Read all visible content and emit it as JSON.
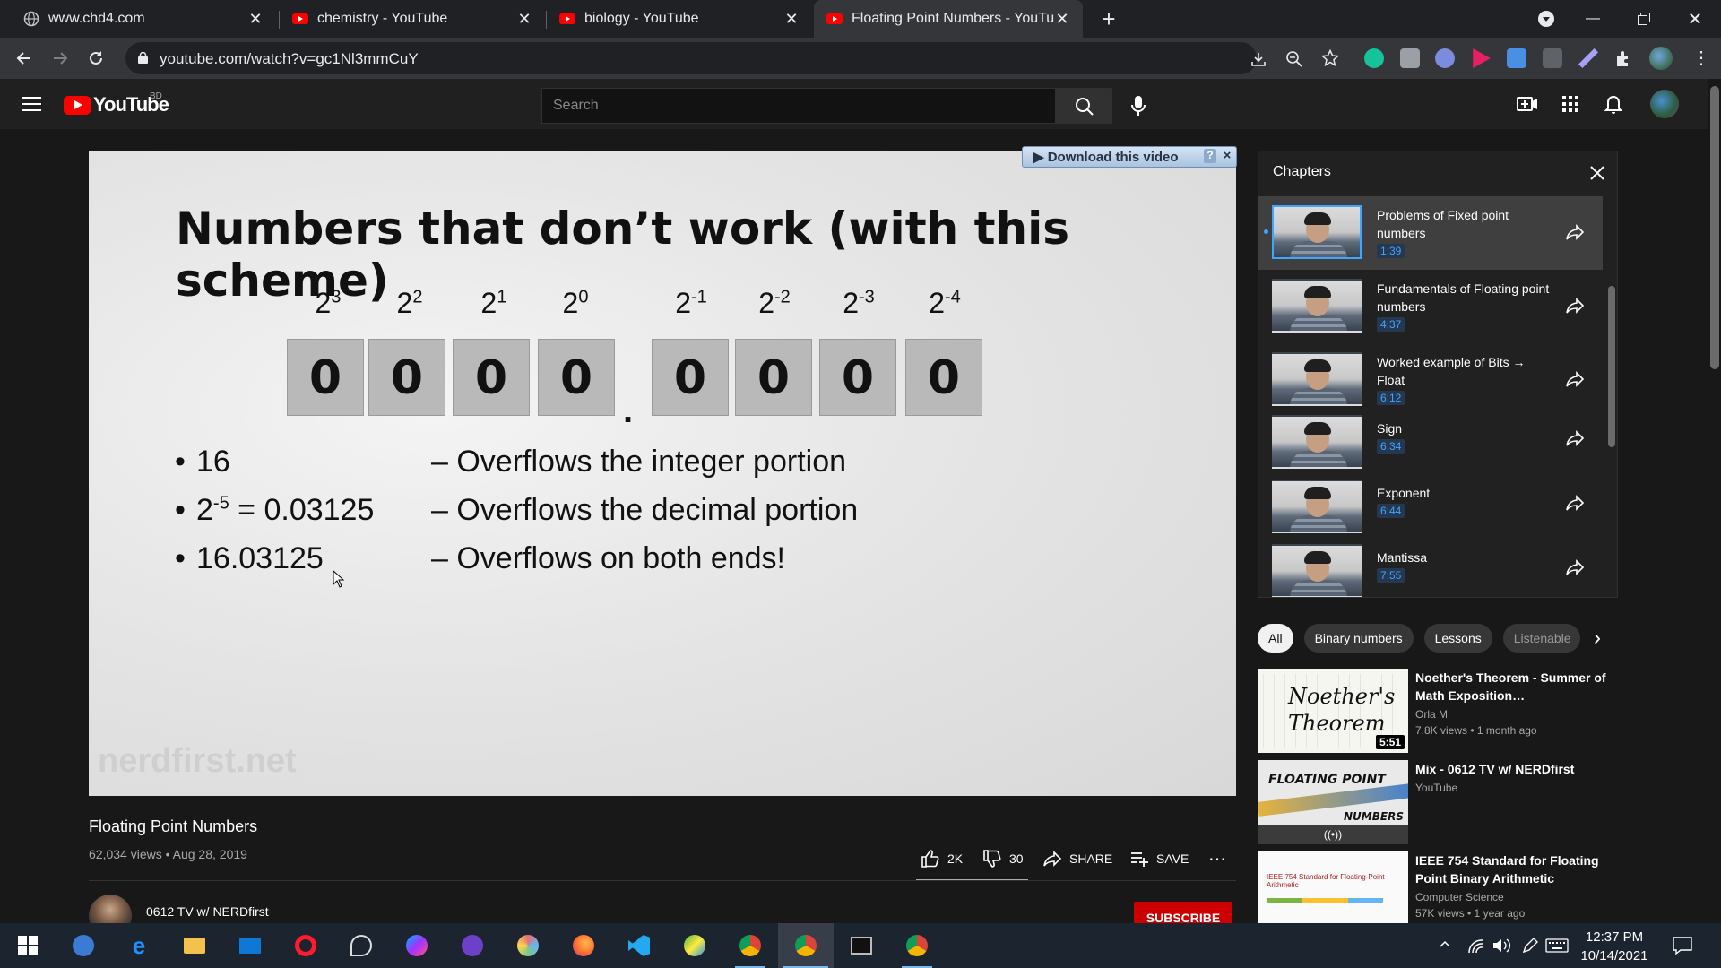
{
  "browser": {
    "tabs": [
      {
        "title": "www.chd4.com",
        "favicon": "globe-icon",
        "active": false
      },
      {
        "title": "chemistry - YouTube",
        "favicon": "youtube-icon",
        "active": false
      },
      {
        "title": "biology - YouTube",
        "favicon": "youtube-icon",
        "active": false
      },
      {
        "title": "Floating Point Numbers - YouTub",
        "favicon": "youtube-icon",
        "active": true
      }
    ],
    "url": "youtube.com/watch?v=gc1Nl3mmCuY"
  },
  "youtube": {
    "logo_text": "YouTube",
    "country_code": "BD",
    "search_placeholder": "Search"
  },
  "player": {
    "download_label": "Download this video",
    "download_help": "?",
    "download_close": "×",
    "slide": {
      "title": "Numbers that don’t work (with this scheme)",
      "exponents": [
        {
          "base": "2",
          "power": "3"
        },
        {
          "base": "2",
          "power": "2"
        },
        {
          "base": "2",
          "power": "1"
        },
        {
          "base": "2",
          "power": "0"
        },
        {
          "base": "2",
          "power": "-1"
        },
        {
          "base": "2",
          "power": "-2"
        },
        {
          "base": "2",
          "power": "-3"
        },
        {
          "base": "2",
          "power": "-4"
        }
      ],
      "bits": [
        "0",
        "0",
        "0",
        "0",
        "0",
        "0",
        "0",
        "0"
      ],
      "point": ".",
      "bullets": [
        {
          "lhs": "16",
          "rhs": "– Overflows the integer portion"
        },
        {
          "lhs_base": "2",
          "lhs_power": "-5",
          "lhs_rest": " = 0.03125",
          "rhs": "– Overflows the decimal portion"
        },
        {
          "lhs": "16.03125",
          "rhs": "– Overflows on both ends!"
        }
      ],
      "watermark": "nerdfirst.net"
    }
  },
  "video": {
    "title": "Floating Point Numbers",
    "meta": "62,034 views • Aug 28, 2019",
    "likes": "2K",
    "dislikes": "30",
    "share_label": "SHARE",
    "save_label": "SAVE",
    "more_label": "⋯",
    "channel": "0612 TV w/ NERDfirst",
    "subscribe_label": "SUBSCRIBE"
  },
  "chapters": {
    "heading": "Chapters",
    "items": [
      {
        "title": "Problems of Fixed point numbers",
        "time": "1:39",
        "active": true
      },
      {
        "title": "Fundamentals of Floating point numbers",
        "time": "4:37",
        "active": false
      },
      {
        "title": "Worked example of Bits → Float",
        "time": "6:12",
        "active": false
      },
      {
        "title": "Sign",
        "time": "6:34",
        "active": false
      },
      {
        "title": "Exponent",
        "time": "6:44",
        "active": false
      },
      {
        "title": "Mantissa",
        "time": "7:55",
        "active": false
      }
    ]
  },
  "chips": [
    "All",
    "Binary numbers",
    "Lessons",
    "Listenable"
  ],
  "related": [
    {
      "title": "Noether's Theorem - Summer of Math Exposition…",
      "channel": "Orla M",
      "stats": "7.8K views • 1 month ago",
      "duration": "5:51",
      "thumb_text": "Noether's Theorem"
    },
    {
      "title": "Mix - 0612 TV w/ NERDfirst",
      "channel": "YouTube",
      "stats": "",
      "duration": "",
      "thumb_text_1": "FLOATING POINT",
      "thumb_text_2": "NUMBERS"
    },
    {
      "title": "IEEE 754 Standard for Floating Point Binary Arithmetic",
      "channel": "Computer Science",
      "stats": "57K views • 1 year ago",
      "duration": "",
      "thumb_text": "IEEE 754 Standard for Floating-Point Arithmetic"
    }
  ],
  "taskbar": {
    "time": "12:37 PM",
    "date": "10/14/2021",
    "apps": [
      "windows-start-icon",
      "qbittorrent-icon",
      "edge-icon",
      "file-explorer-icon",
      "mail-icon",
      "opera-icon",
      "satellite-app-icon",
      "messenger-icon",
      "github-desktop-icon",
      "weather-app-icon",
      "firefox-icon",
      "vscode-icon",
      "globe-app-icon",
      "chrome-icon",
      "chrome-active-icon",
      "terminal-icon",
      "chrome-profile-icon"
    ]
  },
  "colors": {
    "accent_blue": "#3ea6ff",
    "youtube_red": "#ff0000",
    "subscribe_red": "#cc0000",
    "background": "#181818"
  }
}
